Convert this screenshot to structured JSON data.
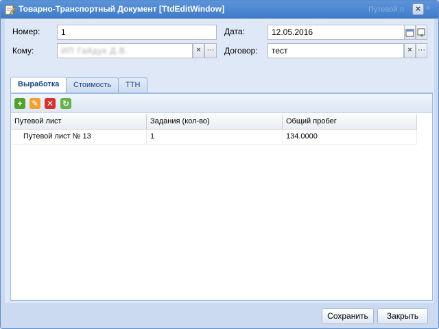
{
  "window": {
    "title": "Товарно-Транспортный Документ [TtdEditWindow]",
    "ghost_title": "Путевой л",
    "close_glyph": "×"
  },
  "form": {
    "number_label": "Номер:",
    "number_value": "1",
    "date_label": "Дата:",
    "date_value": "12.05.2016",
    "to_label": "Кому:",
    "to_value": "ИП Гайдук Д.В.",
    "contract_label": "Договор:",
    "contract_value": "тест",
    "clear_glyph": "×",
    "more_glyph": "···"
  },
  "tabs": [
    {
      "label": "Выработка",
      "active": true
    },
    {
      "label": "Стоимость",
      "active": false
    },
    {
      "label": "ТТН",
      "active": false
    }
  ],
  "toolbar": {
    "add_glyph": "+",
    "edit_glyph": "✎",
    "delete_glyph": "✕",
    "refresh_glyph": "↻"
  },
  "grid": {
    "columns": [
      "Путевой лист",
      "Задания (кол-во)",
      "Общий пробег"
    ],
    "rows": [
      [
        "Путевой лист № 13",
        "1",
        "134.0000"
      ]
    ]
  },
  "footer": {
    "save_label": "Сохранить",
    "close_label": "Закрыть"
  },
  "colors": {
    "titlebar": "#4a86d0",
    "accent": "#15428b"
  }
}
